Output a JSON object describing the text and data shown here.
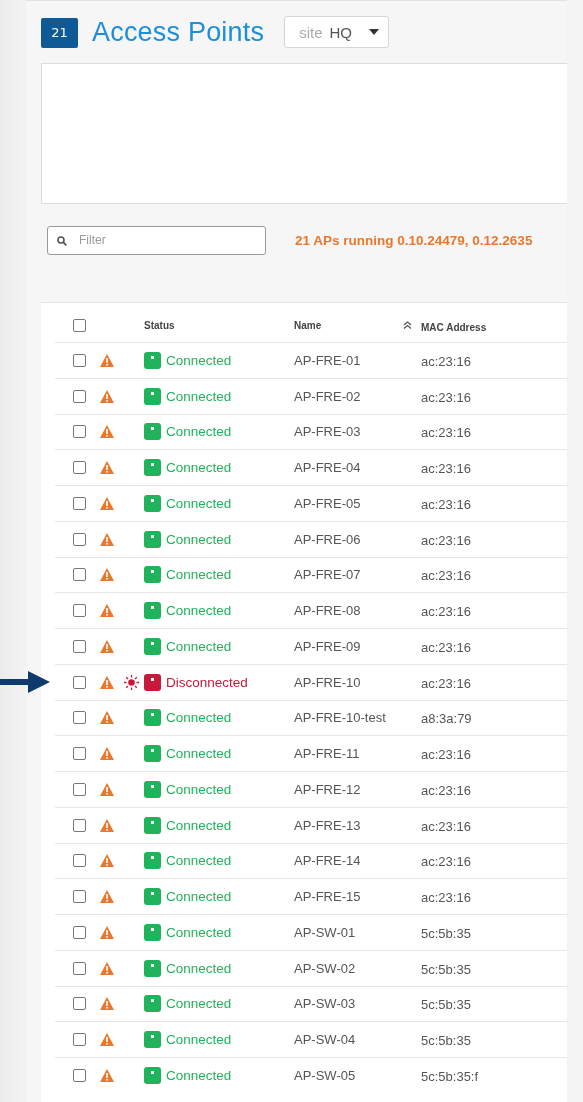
{
  "header": {
    "count": "21",
    "title": "Access Points",
    "site_dropdown": {
      "label": "site",
      "value": "HQ"
    }
  },
  "filter": {
    "placeholder": "Filter"
  },
  "version_notice": "21 APs running 0.10.24479, 0.12.2635",
  "table": {
    "select_all": {
      "checked": false
    },
    "columns": [
      "Status",
      "Name",
      "MAC Address"
    ],
    "rows": [
      {
        "checked": false,
        "warning": true,
        "alarm": false,
        "kind": "connected",
        "status": "Connected",
        "name": "AP-FRE-01",
        "mac": "ac:23:16",
        "arrow": false
      },
      {
        "checked": false,
        "warning": true,
        "alarm": false,
        "kind": "connected",
        "status": "Connected",
        "name": "AP-FRE-02",
        "mac": "ac:23:16",
        "arrow": false
      },
      {
        "checked": false,
        "warning": true,
        "alarm": false,
        "kind": "connected",
        "status": "Connected",
        "name": "AP-FRE-03",
        "mac": "ac:23:16",
        "arrow": false
      },
      {
        "checked": false,
        "warning": true,
        "alarm": false,
        "kind": "connected",
        "status": "Connected",
        "name": "AP-FRE-04",
        "mac": "ac:23:16",
        "arrow": false
      },
      {
        "checked": false,
        "warning": true,
        "alarm": false,
        "kind": "connected",
        "status": "Connected",
        "name": "AP-FRE-05",
        "mac": "ac:23:16",
        "arrow": false
      },
      {
        "checked": false,
        "warning": true,
        "alarm": false,
        "kind": "connected",
        "status": "Connected",
        "name": "AP-FRE-06",
        "mac": "ac:23:16",
        "arrow": false
      },
      {
        "checked": false,
        "warning": true,
        "alarm": false,
        "kind": "connected",
        "status": "Connected",
        "name": "AP-FRE-07",
        "mac": "ac:23:16",
        "arrow": false
      },
      {
        "checked": false,
        "warning": true,
        "alarm": false,
        "kind": "connected",
        "status": "Connected",
        "name": "AP-FRE-08",
        "mac": "ac:23:16",
        "arrow": false
      },
      {
        "checked": false,
        "warning": true,
        "alarm": false,
        "kind": "connected",
        "status": "Connected",
        "name": "AP-FRE-09",
        "mac": "ac:23:16",
        "arrow": false
      },
      {
        "checked": false,
        "warning": true,
        "alarm": true,
        "kind": "disconnected",
        "status": "Disconnected",
        "name": "AP-FRE-10",
        "mac": "ac:23:16",
        "arrow": true
      },
      {
        "checked": false,
        "warning": true,
        "alarm": false,
        "kind": "connected",
        "status": "Connected",
        "name": "AP-FRE-10-test",
        "mac": "a8:3a:79",
        "arrow": false
      },
      {
        "checked": false,
        "warning": true,
        "alarm": false,
        "kind": "connected",
        "status": "Connected",
        "name": "AP-FRE-11",
        "mac": "ac:23:16",
        "arrow": false
      },
      {
        "checked": false,
        "warning": true,
        "alarm": false,
        "kind": "connected",
        "status": "Connected",
        "name": "AP-FRE-12",
        "mac": "ac:23:16",
        "arrow": false
      },
      {
        "checked": false,
        "warning": true,
        "alarm": false,
        "kind": "connected",
        "status": "Connected",
        "name": "AP-FRE-13",
        "mac": "ac:23:16",
        "arrow": false
      },
      {
        "checked": false,
        "warning": true,
        "alarm": false,
        "kind": "connected",
        "status": "Connected",
        "name": "AP-FRE-14",
        "mac": "ac:23:16",
        "arrow": false
      },
      {
        "checked": false,
        "warning": true,
        "alarm": false,
        "kind": "connected",
        "status": "Connected",
        "name": "AP-FRE-15",
        "mac": "ac:23:16",
        "arrow": false
      },
      {
        "checked": false,
        "warning": true,
        "alarm": false,
        "kind": "connected",
        "status": "Connected",
        "name": "AP-SW-01",
        "mac": "5c:5b:35",
        "arrow": false
      },
      {
        "checked": false,
        "warning": true,
        "alarm": false,
        "kind": "connected",
        "status": "Connected",
        "name": "AP-SW-02",
        "mac": "5c:5b:35",
        "arrow": false
      },
      {
        "checked": false,
        "warning": true,
        "alarm": false,
        "kind": "connected",
        "status": "Connected",
        "name": "AP-SW-03",
        "mac": "5c:5b:35",
        "arrow": false
      },
      {
        "checked": false,
        "warning": true,
        "alarm": false,
        "kind": "connected",
        "status": "Connected",
        "name": "AP-SW-04",
        "mac": "5c:5b:35",
        "arrow": false
      },
      {
        "checked": false,
        "warning": true,
        "alarm": false,
        "kind": "connected",
        "status": "Connected",
        "name": "AP-SW-05",
        "mac": "5c:5b:35:f",
        "arrow": false
      }
    ]
  }
}
